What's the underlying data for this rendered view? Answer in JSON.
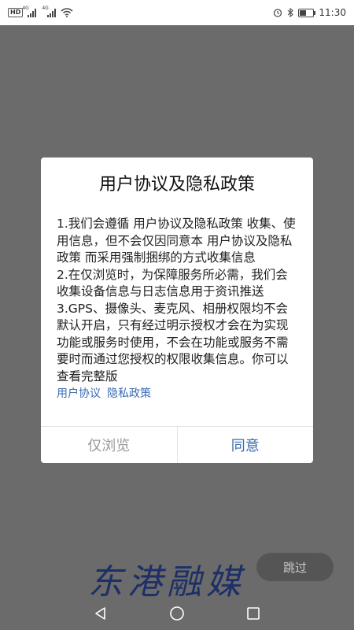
{
  "status_bar": {
    "hd_badge": "HD",
    "signal1_tag": "4G",
    "signal2_tag": "4G",
    "time": "11:30",
    "icons": [
      "hd-icon",
      "signal-icon",
      "signal-icon",
      "wifi-icon",
      "alarm-icon",
      "bluetooth-icon",
      "battery-icon"
    ],
    "battery_level": 0.55
  },
  "dialog": {
    "title": "用户协议及隐私政策",
    "body": [
      "1.我们会遵循 用户协议及隐私政策 收集、使用信息，但不会仅因同意本 用户协议及隐私政策 而采用强制捆绑的方式收集信息",
      "2.在仅浏览时，为保障服务所必需，我们会收集设备信息与日志信息用于资讯推送",
      "3.GPS、摄像头、麦克风、相册权限均不会默认开启，只有经过明示授权才会在为实现功能或服务时使用，不会在功能或服务不需要时而通过您授权的权限收集信息。你可以查看完整版"
    ],
    "link_user_agreement": "用户协议",
    "link_privacy_policy": "隐私政策",
    "btn_browse": "仅浏览",
    "btn_agree": "同意"
  },
  "brand": "东港融媒",
  "skip": "跳过",
  "nav": [
    "back-icon",
    "home-icon",
    "recents-icon"
  ],
  "colors": {
    "overlay": "#6b6b6b",
    "link": "#3a6bb0",
    "brand": "#1d2f66",
    "skip_bg": "#555555"
  }
}
